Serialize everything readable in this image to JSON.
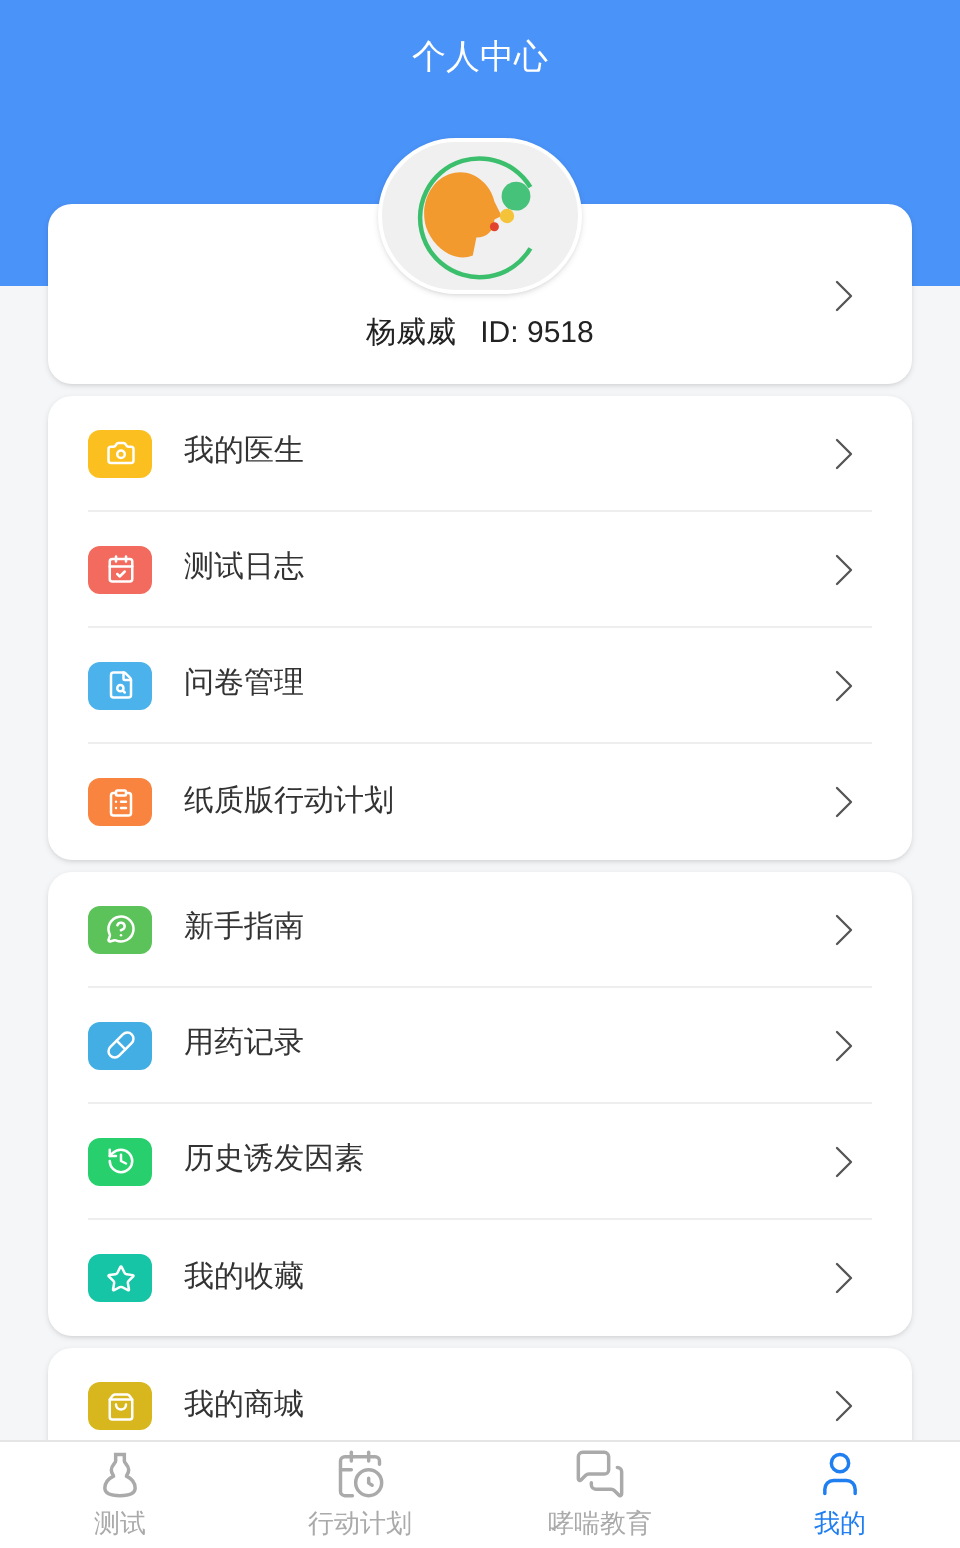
{
  "header": {
    "title": "个人中心"
  },
  "profile": {
    "name": "杨威威",
    "id_label": "ID: 9518"
  },
  "groups": [
    {
      "items": [
        {
          "label": "我的医生",
          "color": "#fbbf1f"
        },
        {
          "label": "测试日志",
          "color": "#f26b5e"
        },
        {
          "label": "问卷管理",
          "color": "#4bb2ec"
        },
        {
          "label": "纸质版行动计划",
          "color": "#f8843f"
        }
      ]
    },
    {
      "items": [
        {
          "label": "新手指南",
          "color": "#5cc25a"
        },
        {
          "label": "用药记录",
          "color": "#43aee3"
        },
        {
          "label": "历史诱发因素",
          "color": "#27d06d"
        },
        {
          "label": "我的收藏",
          "color": "#16c4a6"
        }
      ]
    },
    {
      "items": [
        {
          "label": "我的商城",
          "color": "#d8b71e"
        }
      ]
    }
  ],
  "tabs": [
    {
      "label": "测试",
      "selected": false
    },
    {
      "label": "行动计划",
      "selected": false
    },
    {
      "label": "哮喘教育",
      "selected": false
    },
    {
      "label": "我的",
      "selected": true
    }
  ]
}
